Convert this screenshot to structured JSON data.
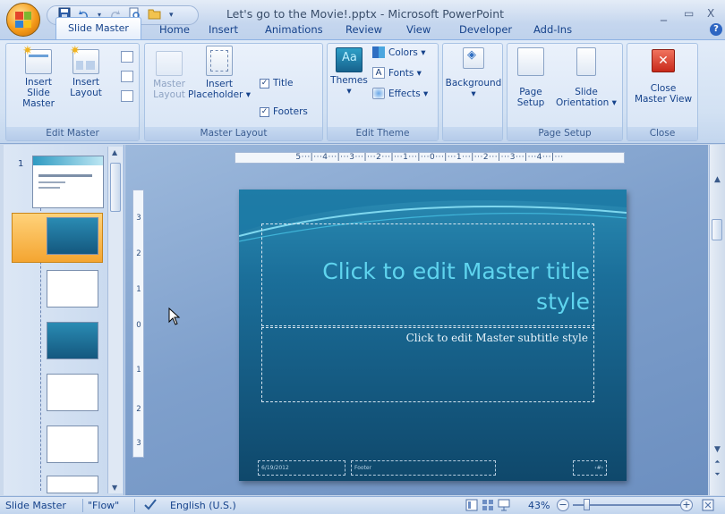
{
  "window": {
    "title": "Let's go to the Movie!.pptx - Microsoft PowerPoint",
    "minimize": "_",
    "restore": "▭",
    "close": "X"
  },
  "qat": {
    "more": "▾"
  },
  "tabs": [
    "Slide Master",
    "Home",
    "Insert",
    "Animations",
    "Review",
    "View",
    "Developer",
    "Add-Ins"
  ],
  "help": "?",
  "ribbon": {
    "edit_master": {
      "label": "Edit Master",
      "insert_slide_master": [
        "Insert Slide",
        "Master"
      ],
      "insert_layout": [
        "Insert",
        "Layout"
      ]
    },
    "master_layout": {
      "label": "Master Layout",
      "master_layout_btn": [
        "Master",
        "Layout"
      ],
      "insert_placeholder": [
        "Insert",
        "Placeholder ▾"
      ],
      "title_check": "Title",
      "footers_check": "Footers",
      "title_checked": true,
      "footers_checked": true
    },
    "edit_theme": {
      "label": "Edit Theme",
      "themes": [
        "Themes",
        "▾"
      ],
      "colors": "Colors ▾",
      "fonts": "Fonts ▾",
      "effects": "Effects ▾"
    },
    "background": {
      "label": [
        "Background",
        "▾"
      ]
    },
    "page_setup": {
      "label": "Page Setup",
      "page_setup_btn": [
        "Page",
        "Setup"
      ],
      "slide_orientation": [
        "Slide",
        "Orientation ▾"
      ]
    },
    "close": {
      "label": "Close",
      "close_master_view": [
        "Close",
        "Master View"
      ]
    }
  },
  "thumbnails": {
    "master_number": "1"
  },
  "ruler": {
    "horizontal": "5···|···4···|···3···|···2···|···1···|···0···|···1···|···2···|···3···|···4···|···",
    "vertical_marks": [
      "3",
      "2",
      "1",
      "0",
      "1",
      "2",
      "3"
    ]
  },
  "slide": {
    "title": "Click to edit Master title style",
    "subtitle": "Click to edit Master subtitle style",
    "footer_date": "6/19/2012",
    "footer_text": "Footer",
    "footer_num": "‹#›"
  },
  "status": {
    "view": "Slide Master",
    "theme": "\"Flow\"",
    "language": "English (U.S.)",
    "zoom": "43%",
    "zoom_minus": "−",
    "zoom_plus": "+"
  },
  "colors": {
    "ribbon_bg": "#d2e1f3",
    "slide_bg": "#14587f",
    "title_text": "#5fd4ee",
    "selection": "#f4a531"
  }
}
